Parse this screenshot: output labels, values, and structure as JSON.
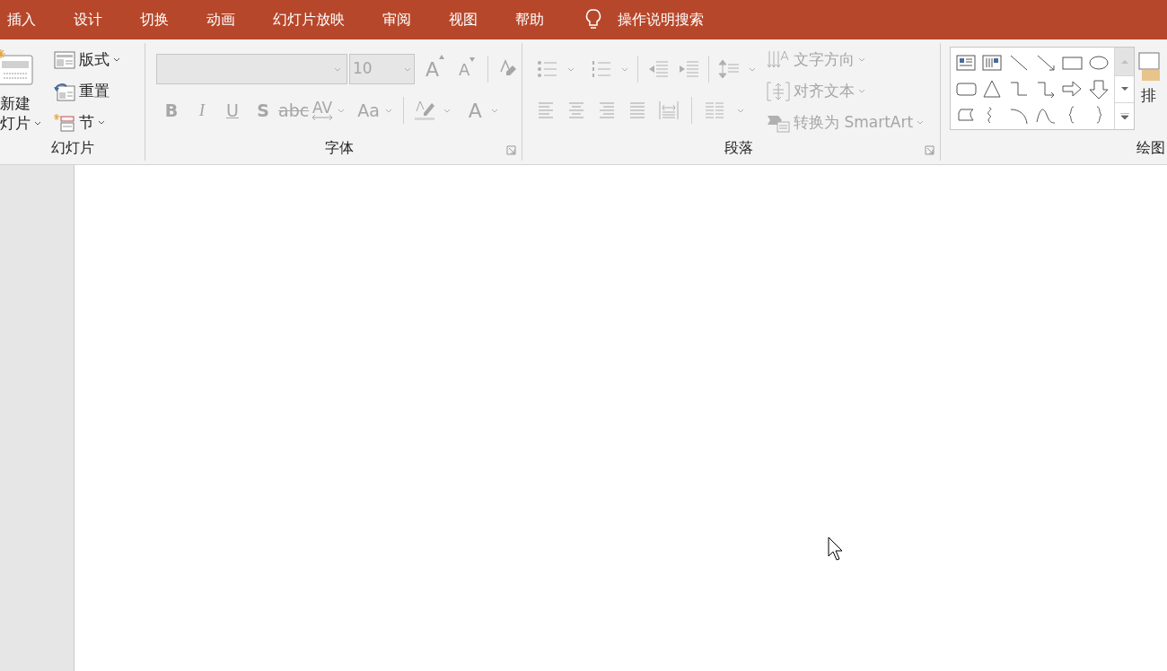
{
  "tabs": [
    {
      "label": "插入"
    },
    {
      "label": "设计"
    },
    {
      "label": "切换"
    },
    {
      "label": "动画"
    },
    {
      "label": "幻灯片放映"
    },
    {
      "label": "审阅"
    },
    {
      "label": "视图"
    },
    {
      "label": "帮助"
    }
  ],
  "tell_me": {
    "placeholder": "操作说明搜索"
  },
  "ribbon": {
    "groups": [
      {
        "kind": "slides",
        "label": "幻灯片",
        "disabled": false,
        "new_slide": [
          "新建",
          "灯片"
        ],
        "items": [
          "版式",
          "重置",
          "节"
        ]
      },
      {
        "kind": "font",
        "label": "字体",
        "disabled": true,
        "font_size": "10",
        "grow": "A",
        "shrink": "A",
        "formats": [
          "B",
          "I",
          "U",
          "S",
          "abc"
        ],
        "spacing": "AV",
        "change_case": "Aa",
        "font_color": "A"
      },
      {
        "kind": "paragraph",
        "label": "段落",
        "disabled": true,
        "commands": [
          "文字方向",
          "对齐文本",
          "转换为 SmartArt"
        ]
      },
      {
        "kind": "drawing",
        "label": "绘图",
        "arrange": "排"
      }
    ]
  }
}
